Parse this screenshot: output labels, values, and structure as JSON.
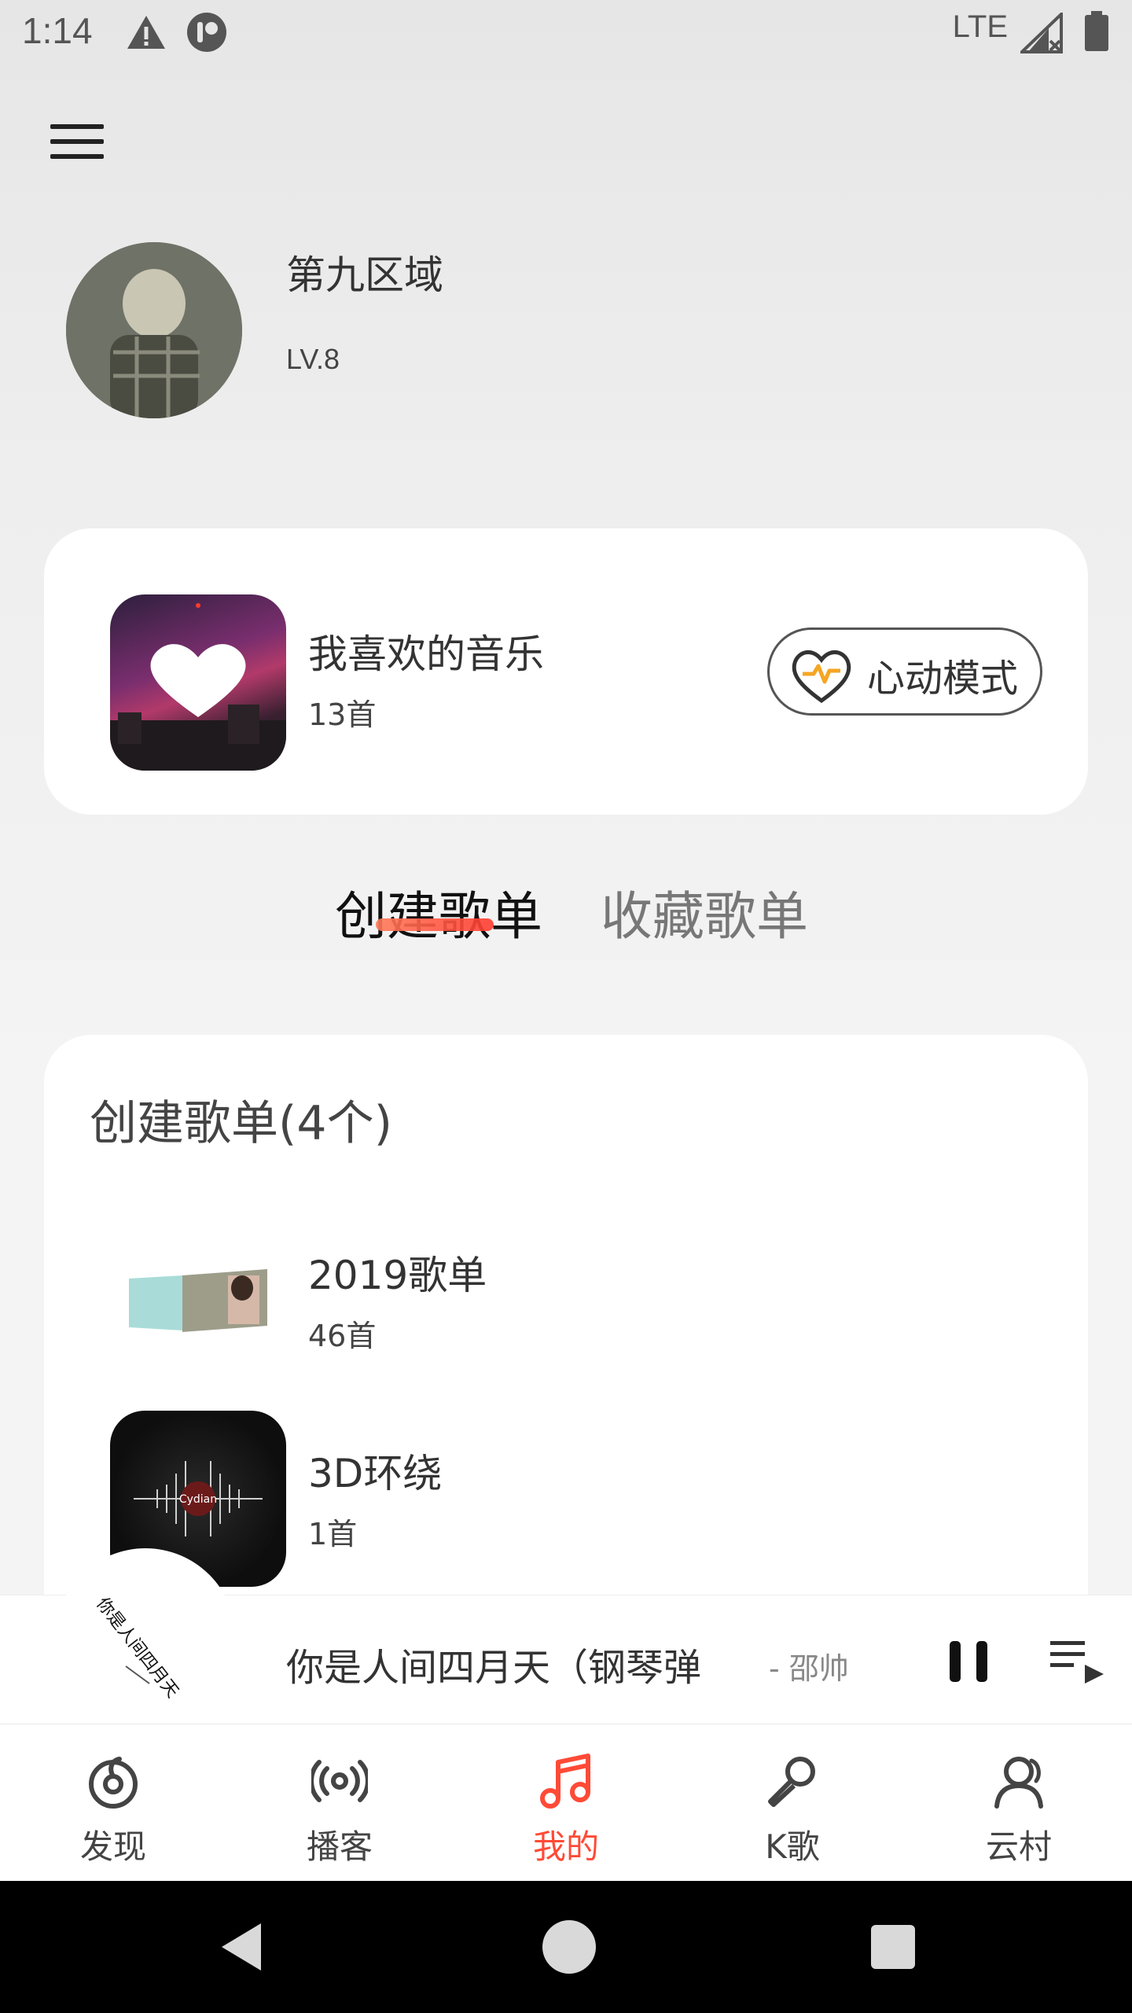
{
  "status_bar": {
    "time": "1:14",
    "network": "LTE",
    "icons": [
      "warning-icon",
      "app-badge-icon",
      "signal-icon",
      "battery-icon"
    ]
  },
  "header": {
    "menu_icon": "menu-icon"
  },
  "profile": {
    "name": "第九区域",
    "level": "LV.8"
  },
  "liked_music": {
    "title": "我喜欢的音乐",
    "count": "13首",
    "heart_mode_label": "心动模式"
  },
  "tabs": [
    {
      "label": "创建歌单",
      "active": true
    },
    {
      "label": "收藏歌单",
      "active": false
    }
  ],
  "playlists": {
    "heading": "创建歌单(4个)",
    "items": [
      {
        "name": "2019歌单",
        "count": "46首"
      },
      {
        "name": "3D环绕",
        "count": "1首",
        "cover_text": "Cydian"
      }
    ]
  },
  "mini_player": {
    "title": "你是人间四月天（钢琴弹",
    "artist": "- 邵帅",
    "disc_text": "你是人间四月天"
  },
  "bottom_nav": [
    {
      "label": "发现",
      "icon": "discover-icon",
      "active": false
    },
    {
      "label": "播客",
      "icon": "podcast-icon",
      "active": false
    },
    {
      "label": "我的",
      "icon": "music-note-icon",
      "active": true
    },
    {
      "label": "K歌",
      "icon": "microphone-icon",
      "active": false
    },
    {
      "label": "云村",
      "icon": "community-icon",
      "active": false
    }
  ],
  "colors": {
    "accent": "#ff4a36",
    "background": "#eeeeee",
    "card": "#ffffff",
    "heart_pulse": "#f5a623"
  }
}
